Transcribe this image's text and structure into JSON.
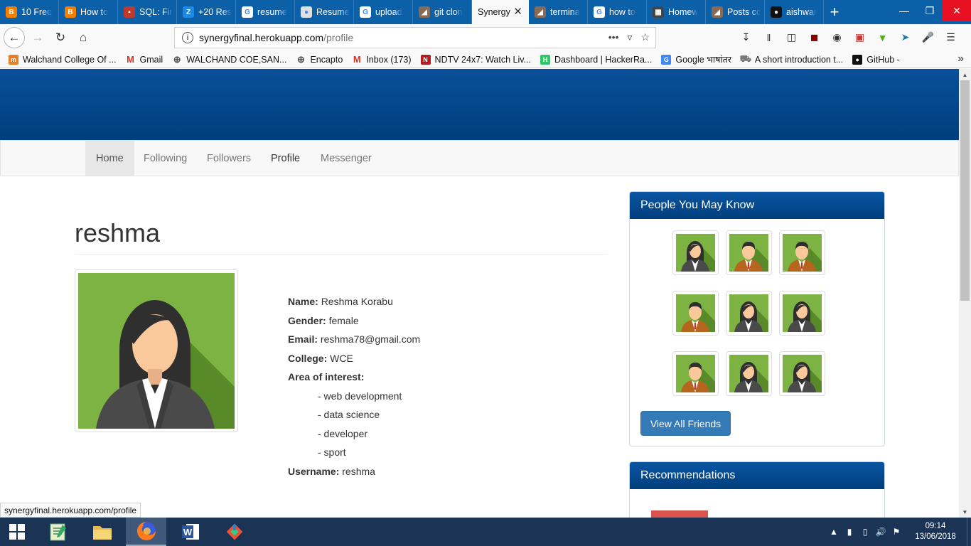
{
  "browser": {
    "tabs": [
      {
        "label": "10 Freq",
        "favicon": "blogger-icon",
        "color": "#f57d00",
        "glyph": "B"
      },
      {
        "label": "How to",
        "favicon": "blogger-icon",
        "color": "#f57d00",
        "glyph": "B"
      },
      {
        "label": "SQL: Fir",
        "favicon": "site-icon",
        "color": "#c0392b",
        "glyph": "▪"
      },
      {
        "label": "+20 Res",
        "favicon": "z-icon",
        "color": "#1e88e5",
        "glyph": "Z"
      },
      {
        "label": "resume",
        "favicon": "google-icon",
        "color": "#ffffff",
        "glyph": "G"
      },
      {
        "label": "Resume",
        "favicon": "resume-icon",
        "color": "#e0e0e0",
        "glyph": "●"
      },
      {
        "label": "upload",
        "favicon": "google-icon",
        "color": "#ffffff",
        "glyph": "G"
      },
      {
        "label": "git clon",
        "favicon": "page-icon",
        "color": "#8a6a55",
        "glyph": "◢"
      },
      {
        "label": "Synergy",
        "favicon": "",
        "color": "",
        "glyph": "",
        "active": true
      },
      {
        "label": "termina",
        "favicon": "page-icon",
        "color": "#8a6a55",
        "glyph": "◢"
      },
      {
        "label": "how to",
        "favicon": "google-icon",
        "color": "#ffffff",
        "glyph": "G"
      },
      {
        "label": "Homew",
        "favicon": "grid-icon",
        "color": "#444444",
        "glyph": "▦"
      },
      {
        "label": "Posts cc",
        "favicon": "page-icon",
        "color": "#8a6a55",
        "glyph": "◢"
      },
      {
        "label": "aishwar",
        "favicon": "github-icon",
        "color": "#111111",
        "glyph": "●"
      }
    ],
    "url_host": "synergyfinal.herokuapp.com",
    "url_path": "/profile",
    "bookmarks": [
      {
        "label": "Walchand College Of ...",
        "icon": "m-icon",
        "color": "#e67e22",
        "glyph": "m"
      },
      {
        "label": "Gmail",
        "icon": "gmail-icon",
        "color": "#d93025",
        "glyph": "M"
      },
      {
        "label": "WALCHAND COE,SAN...",
        "icon": "globe-icon",
        "color": "#555555",
        "glyph": "⊕"
      },
      {
        "label": "Encapto",
        "icon": "globe-icon",
        "color": "#555555",
        "glyph": "⊕"
      },
      {
        "label": "Inbox (173)",
        "icon": "gmail-icon",
        "color": "#d93025",
        "glyph": "M"
      },
      {
        "label": "NDTV 24x7: Watch Liv...",
        "icon": "ndtv-icon",
        "color": "#b71c1c",
        "glyph": "N"
      },
      {
        "label": "Dashboard | HackerRa...",
        "icon": "hackerrank-icon",
        "color": "#2ec866",
        "glyph": "H"
      },
      {
        "label": "Google भाषांतर",
        "icon": "translate-icon",
        "color": "#4285f4",
        "glyph": "G"
      },
      {
        "label": "A short introduction t...",
        "icon": "cart-icon",
        "color": "#777777",
        "glyph": "⛟"
      },
      {
        "label": "GitHub -",
        "icon": "github-icon",
        "color": "#111111",
        "glyph": "●"
      }
    ],
    "status_link": "synergyfinal.herokuapp.com/profile"
  },
  "site": {
    "nav": [
      "Home",
      "Following",
      "Followers",
      "Profile",
      "Messenger"
    ],
    "profile": {
      "heading": "reshma",
      "fields": [
        {
          "label": "Name:",
          "value": "Reshma Korabu"
        },
        {
          "label": "Gender:",
          "value": "female"
        },
        {
          "label": "Email:",
          "value": "reshma78@gmail.com"
        },
        {
          "label": "College:",
          "value": "WCE"
        },
        {
          "label": "Area of interest:",
          "value": ""
        }
      ],
      "interests": [
        "- web development",
        "- data science",
        "- developer",
        "- sport"
      ],
      "username_label": "Username:",
      "username": "reshma"
    },
    "people_panel": {
      "title": "People You May Know",
      "avatars": [
        "female",
        "male",
        "male",
        "male",
        "female",
        "female",
        "male",
        "female",
        "female"
      ],
      "button": "View All Friends"
    },
    "recommendations_panel": {
      "title": "Recommendations"
    }
  },
  "taskbar": {
    "apps": [
      "notepad-icon",
      "file-explorer-icon",
      "firefox-icon",
      "word-icon",
      "git-icon"
    ],
    "time": "09:14",
    "date": "13/06/2018"
  },
  "colors": {
    "tabbar": "#0c60a8",
    "banner": "#004a92",
    "panel_heading": "#0a56a3",
    "button": "#337ab7",
    "avatar_bg": "#7cb342"
  }
}
